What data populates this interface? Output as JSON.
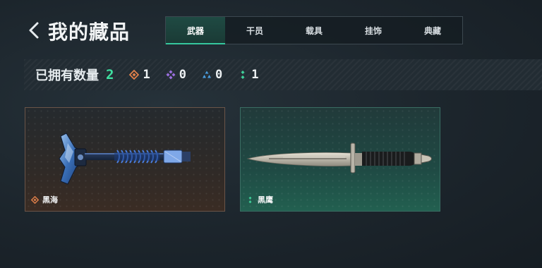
{
  "header": {
    "title": "我的藏品"
  },
  "tabs": [
    {
      "label": "武器",
      "active": true
    },
    {
      "label": "干员",
      "active": false
    },
    {
      "label": "载具",
      "active": false
    },
    {
      "label": "挂饰",
      "active": false
    },
    {
      "label": "典藏",
      "active": false
    }
  ],
  "stats": {
    "owned_label": "已拥有数量",
    "owned_count": "2",
    "rarity_counts": [
      {
        "icon": "orange-diamond-icon",
        "color": "#e0804a",
        "count": "1"
      },
      {
        "icon": "purple-cluster-icon",
        "color": "#9b6fe0",
        "count": "0"
      },
      {
        "icon": "blue-triangle-icon",
        "color": "#4a9ee0",
        "count": "0"
      },
      {
        "icon": "green-dots-icon",
        "color": "#3fd09a",
        "count": "1"
      }
    ]
  },
  "items": [
    {
      "name": "黑海",
      "rarity_icon": "orange-diamond-icon",
      "rarity_color": "#e0804a",
      "weapon": "tomahawk"
    },
    {
      "name": "黑鹰",
      "rarity_icon": "green-dots-icon",
      "rarity_color": "#3fd09a",
      "weapon": "combat-knife"
    }
  ]
}
